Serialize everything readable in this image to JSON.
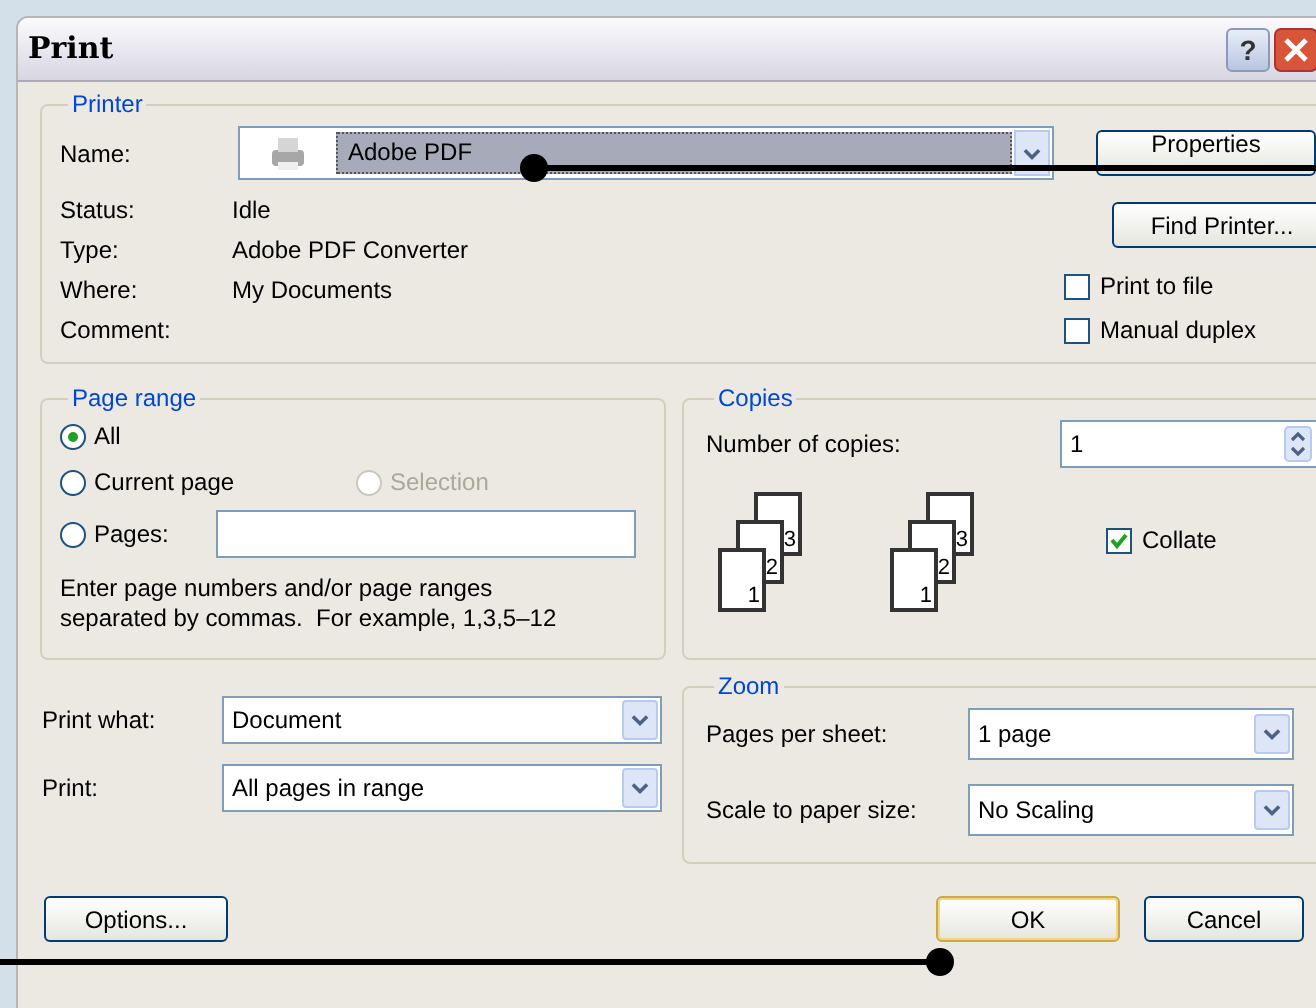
{
  "window": {
    "title": "Print",
    "help_button": "?"
  },
  "printer": {
    "label": "Printer",
    "name_label": "Name:",
    "name_value": "Adobe PDF",
    "details": [
      {
        "label": "Status:",
        "value": "Idle"
      },
      {
        "label": "Type:",
        "value": "Adobe PDF Converter"
      },
      {
        "label": "Where:",
        "value": "My Documents"
      },
      {
        "label": "Comment:"
      }
    ],
    "buttons": [
      "Properties",
      "Find Printer..."
    ],
    "checkboxes": [
      {
        "label": "Print to file",
        "checked": false
      },
      {
        "label": "Manual duplex",
        "checked": false
      }
    ]
  },
  "page_range": {
    "label": "Page range",
    "options": [
      {
        "label": "All",
        "selected": true,
        "disabled": false
      },
      {
        "label": "Current page",
        "selected": false,
        "disabled": false
      },
      {
        "label": "Selection",
        "selected": false,
        "disabled": true
      },
      {
        "label": "Pages:",
        "selected": false,
        "disabled": false
      }
    ],
    "hint": "Enter page numbers and/or page ranges separated by commas.  For example, 1,3,5–12"
  },
  "copies": {
    "label": "Copies",
    "count_label": "Number of copies:",
    "count_value": "1",
    "stacks": [
      {
        "pages": [
          "1",
          "2",
          "3"
        ]
      },
      {
        "pages": [
          "1",
          "2",
          "3"
        ]
      }
    ],
    "collate": {
      "label": "Collate",
      "checked": true
    }
  },
  "print_options": [
    {
      "label": "Print what:",
      "value": "Document"
    },
    {
      "label": "Print:",
      "value": "All pages in range"
    }
  ],
  "zoom": {
    "label": "Zoom",
    "rows": [
      {
        "label": "Pages per sheet:",
        "value": "1 page"
      },
      {
        "label": "Scale to paper size:",
        "value": "No Scaling"
      }
    ]
  },
  "buttons": [
    {
      "label": "Options...",
      "default": false
    },
    {
      "label": "OK",
      "default": true
    },
    {
      "label": "Cancel",
      "default": false
    }
  ]
}
